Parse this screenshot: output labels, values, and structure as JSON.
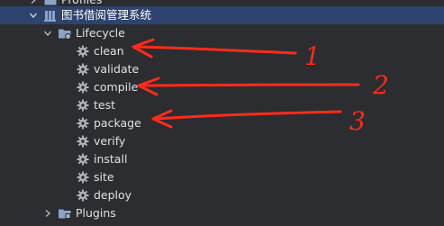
{
  "tree": {
    "top_partial": {
      "label": "Profiles"
    },
    "project": {
      "label": "图书借阅管理系统",
      "expanded": true
    },
    "lifecycle": {
      "label": "Lifecycle",
      "expanded": true
    },
    "goals": [
      {
        "label": "clean"
      },
      {
        "label": "validate"
      },
      {
        "label": "compile"
      },
      {
        "label": "test"
      },
      {
        "label": "package"
      },
      {
        "label": "verify"
      },
      {
        "label": "install"
      },
      {
        "label": "site"
      },
      {
        "label": "deploy"
      }
    ],
    "plugins": {
      "label": "Plugins",
      "expanded": false
    }
  },
  "annotations": [
    {
      "number": "1",
      "points_to": "clean",
      "color": "#ff2a1a"
    },
    {
      "number": "2",
      "points_to": "compile",
      "color": "#ff2a1a"
    },
    {
      "number": "3",
      "points_to": "package",
      "color": "#ff2a1a"
    }
  ],
  "colors": {
    "background": "#2b2d30",
    "selection": "#2e436e",
    "text": "#dfe1e5",
    "gear": "#aeb2b8",
    "folder": "#8aa4c8",
    "annotation": "#ff2a1a"
  }
}
